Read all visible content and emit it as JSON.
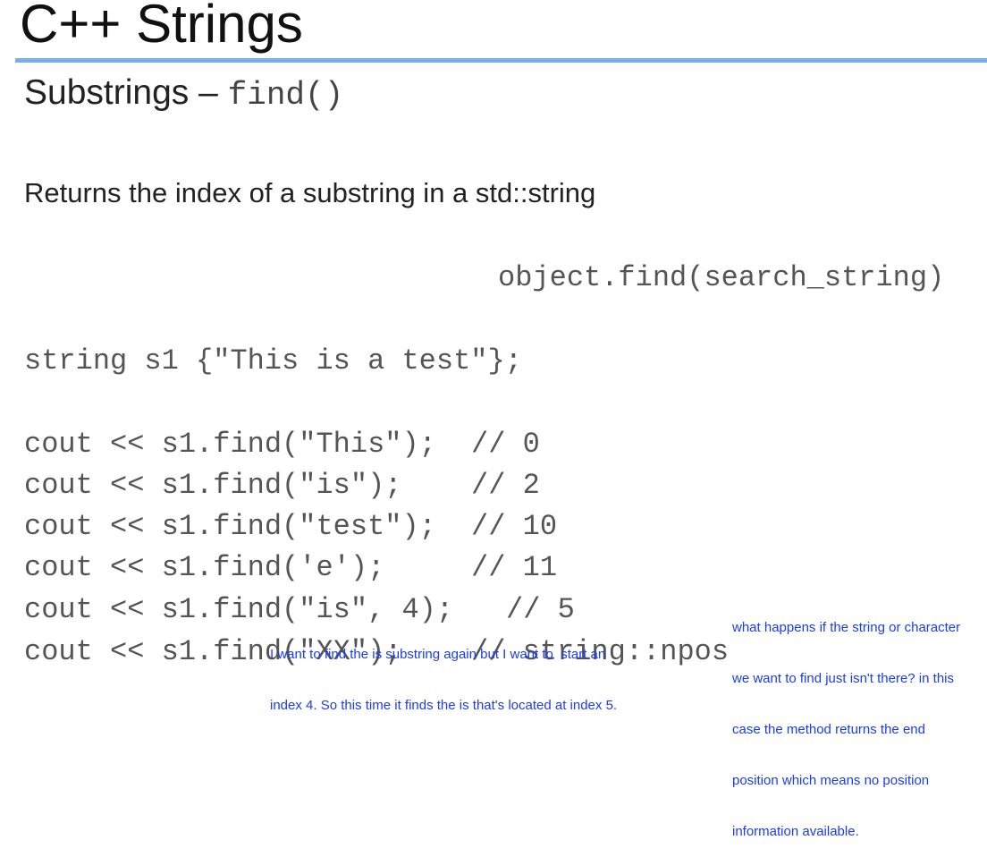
{
  "slide": {
    "title": "C++ Strings",
    "subtitle_text": "Substrings – ",
    "subtitle_code": "find()",
    "description": "Returns the index of a substring in a std::string",
    "syntax": "object.find(search_string)",
    "declaration": "string s1 {\"This is a test\"};",
    "code_lines": [
      {
        "code": "cout << s1.find(\"This\");",
        "comment": "// 0"
      },
      {
        "code": "cout << s1.find(\"is\");",
        "comment": "// 2"
      },
      {
        "code": "cout << s1.find(\"test\");",
        "comment": "// 10"
      },
      {
        "code": "cout << s1.find('e');",
        "comment": "// 11"
      },
      {
        "code": "cout << s1.find(\"is\", 4);",
        "comment": "// 5"
      },
      {
        "code": "cout << s1.find(\"XX\");",
        "comment": "// string::npos"
      }
    ]
  },
  "annotations": {
    "left": [
      "I want to find the is substring again but I want to  start an",
      "index 4. So this time it finds the is that's located at index 5."
    ],
    "right": [
      "what happens if the string or character",
      "we want to find just isn't there? in this",
      "case the method returns the end",
      "position which means no position",
      "information available."
    ]
  },
  "colors": {
    "rule": "#7aaeee",
    "annotation": "#1a3cf5"
  }
}
